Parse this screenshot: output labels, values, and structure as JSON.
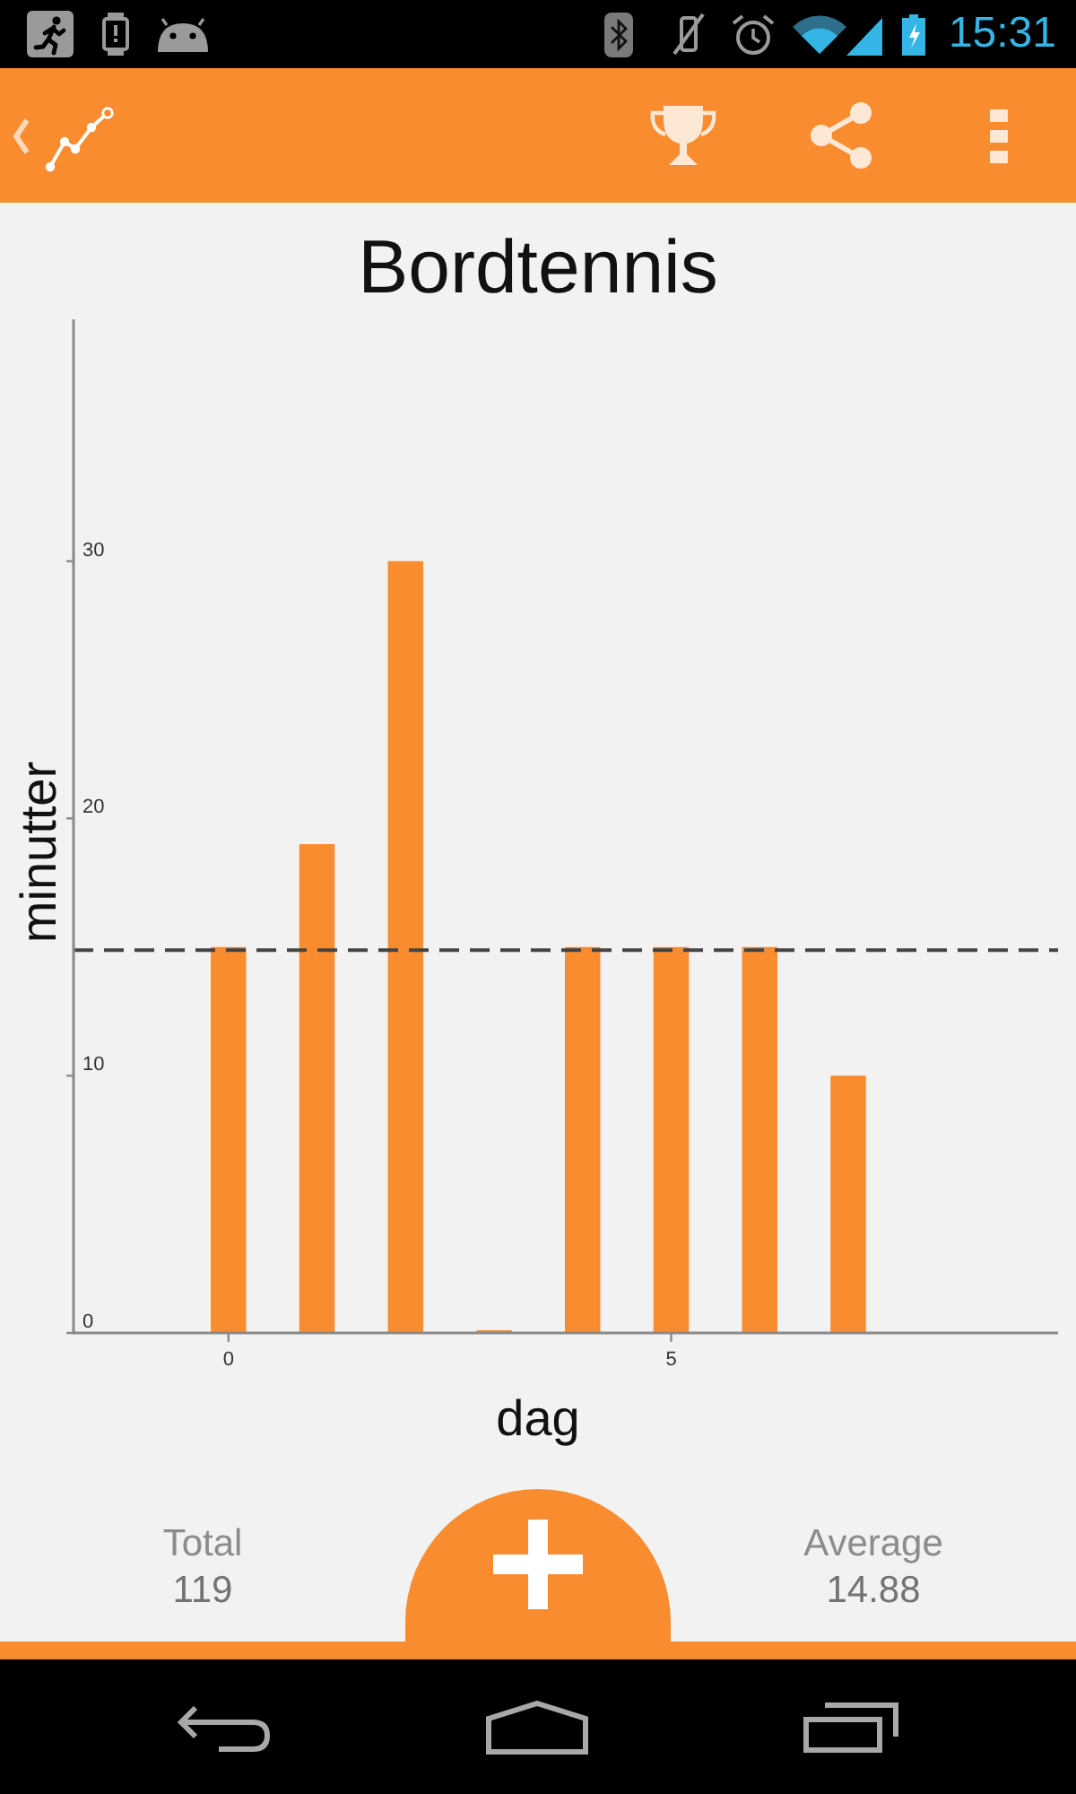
{
  "status_bar": {
    "time": "15:31"
  },
  "chart": {
    "chart_data": {
      "type": "bar",
      "title": "Bordtennis",
      "xlabel": "dag",
      "ylabel": "minutter",
      "x": [
        0,
        1,
        2,
        3,
        4,
        5,
        6,
        7
      ],
      "values": [
        15,
        19,
        30,
        0,
        15,
        15,
        15,
        10
      ],
      "xlim": [
        -1.75,
        9.37
      ],
      "ylim": [
        0,
        39.4
      ],
      "xticks": [
        0,
        5
      ],
      "yticks": [
        0,
        10,
        20,
        30
      ],
      "ref_lines": [
        {
          "axis": "y",
          "value": 14.88
        }
      ]
    }
  },
  "stats": [
    {
      "label": "Total",
      "value": "119"
    },
    {
      "label": "Average",
      "value": "14.88"
    }
  ]
}
